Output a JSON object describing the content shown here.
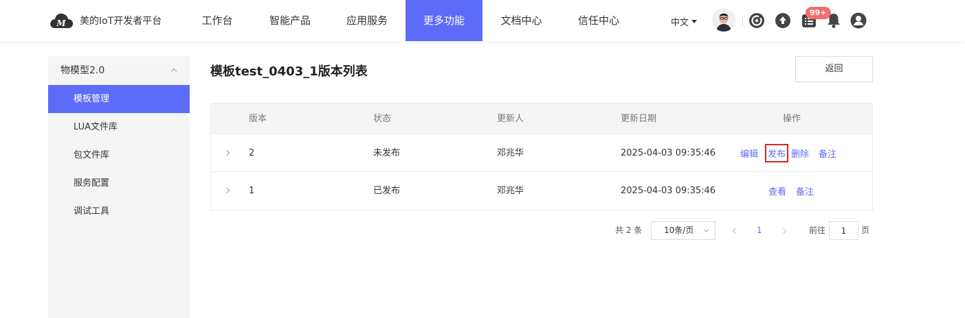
{
  "header": {
    "logo_text": "美的IoT开发者平台",
    "nav": [
      {
        "label": "工作台"
      },
      {
        "label": "智能产品"
      },
      {
        "label": "应用服务"
      },
      {
        "label": "更多功能",
        "active": true
      },
      {
        "label": "文档中心"
      },
      {
        "label": "信任中心"
      }
    ],
    "language": "中文",
    "badge": "99+",
    "icons": [
      "target-icon",
      "upload-icon",
      "list-icon",
      "bell-icon",
      "user-icon"
    ]
  },
  "sidebar": {
    "group_label": "物模型2.0",
    "items": [
      {
        "label": "模板管理",
        "active": true
      },
      {
        "label": "LUA文件库"
      },
      {
        "label": "包文件库"
      },
      {
        "label": "服务配置"
      },
      {
        "label": "调试工具"
      }
    ]
  },
  "main": {
    "title": "模板test_0403_1版本列表",
    "back_label": "返回"
  },
  "table": {
    "columns": [
      "版本",
      "状态",
      "更新人",
      "更新日期",
      "操作"
    ],
    "rows": [
      {
        "version": "2",
        "status": "未发布",
        "updater": "邓兆华",
        "date": "2025-04-03 09:35:46",
        "actions": [
          "编辑",
          "发布",
          "删除",
          "备注"
        ]
      },
      {
        "version": "1",
        "status": "已发布",
        "updater": "邓兆华",
        "date": "2025-04-03 09:35:46",
        "actions": [
          "查看",
          "备注"
        ]
      }
    ]
  },
  "pagination": {
    "total": "共 2 条",
    "page_size": "10条/页",
    "current_page": "1",
    "goto_label": "前往",
    "goto_value": "1",
    "page_suffix": "页"
  },
  "colors": {
    "accent": "#5d6cf8",
    "highlight": "#e02020",
    "badge": "#f56c6c"
  }
}
